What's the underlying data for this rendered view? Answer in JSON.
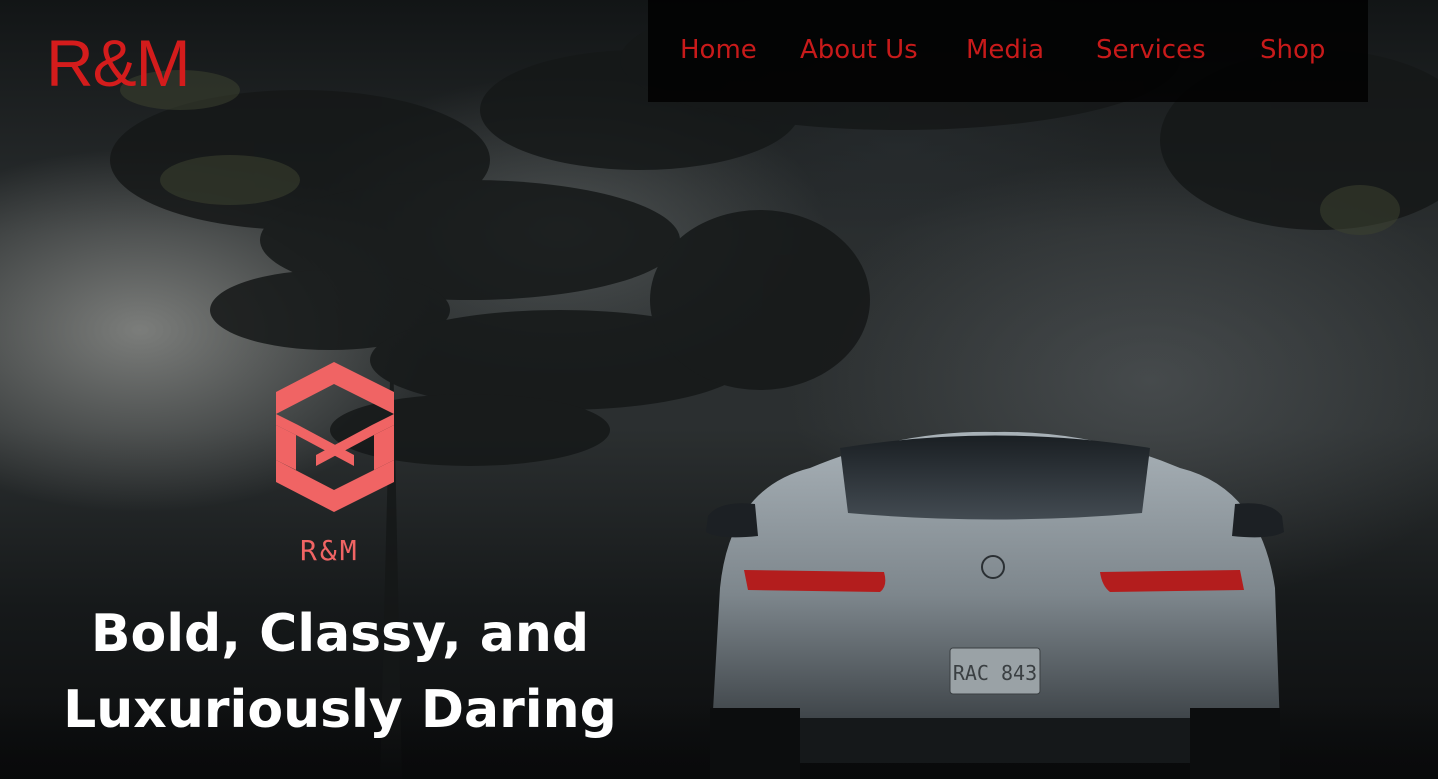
{
  "header": {
    "brand": "R&M",
    "nav": [
      {
        "label": "Home"
      },
      {
        "label": "About Us"
      },
      {
        "label": "Media"
      },
      {
        "label": "Services"
      },
      {
        "label": "Shop"
      }
    ]
  },
  "hero": {
    "emblem_text": "R&M",
    "tagline_line1": "Bold, Classy, and",
    "tagline_line2": "Luxuriously Daring",
    "license_plate": "RAC 843"
  },
  "colors": {
    "brand_red": "#d41c1c",
    "emblem_coral": "#f06464",
    "nav_bg": "#000000",
    "text_white": "#ffffff"
  }
}
